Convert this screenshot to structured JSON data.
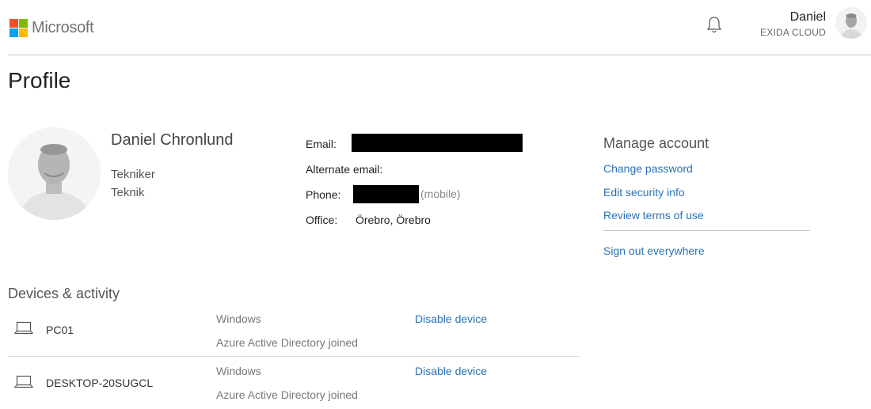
{
  "header": {
    "brand": "Microsoft",
    "logo_colors": [
      "#f25022",
      "#7fba00",
      "#00a4ef",
      "#ffb900"
    ],
    "user_name": "Daniel",
    "user_org": "EXIDA CLOUD",
    "notification_icon": "bell-icon"
  },
  "page": {
    "title": "Profile"
  },
  "profile": {
    "full_name": "Daniel Chronlund",
    "job_title": "Tekniker",
    "department": "Teknik",
    "fields": {
      "email_label": "Email:",
      "alternate_email_label": "Alternate email:",
      "phone_label": "Phone:",
      "phone_note": "(mobile)",
      "office_label": "Office:",
      "office_value": "Örebro, Örebro"
    }
  },
  "manage_account": {
    "title": "Manage account",
    "links": [
      "Change password",
      "Edit security info",
      "Review terms of use"
    ],
    "sign_out": "Sign out everywhere"
  },
  "devices": {
    "title": "Devices & activity",
    "items": [
      {
        "name": "PC01",
        "os": "Windows",
        "join_type": "Azure Active Directory joined",
        "action": "Disable device",
        "icon": "laptop-icon"
      },
      {
        "name": "DESKTOP-20SUGCL",
        "os": "Windows",
        "join_type": "Azure Active Directory joined",
        "action": "Disable device",
        "icon": "laptop-icon"
      }
    ]
  },
  "colors": {
    "link": "#2b72b5",
    "redaction": "#000000"
  }
}
